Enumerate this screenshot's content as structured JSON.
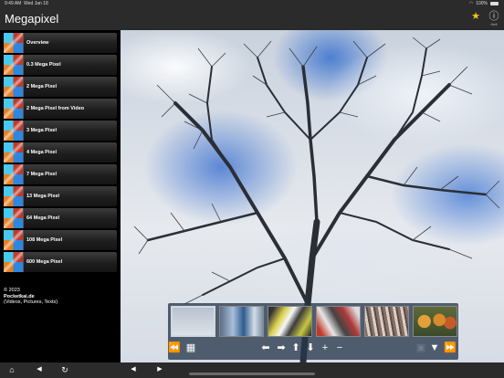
{
  "status_bar": {
    "time": "9:49 AM",
    "date": "Wed Jan 18",
    "battery": "100%"
  },
  "header": {
    "title": "Megapixel",
    "favorite_icon": "star-icon",
    "info_icon": "info-icon",
    "info_label": "Hell",
    "colors": {
      "star": "#f5c518",
      "bar": "#2b2b2b"
    }
  },
  "sidebar": {
    "items": [
      {
        "label": "Overview"
      },
      {
        "label": "0.3 Mega Pixel"
      },
      {
        "label": "2 Mega Pixel"
      },
      {
        "label": "2 Mega Pixel from Video"
      },
      {
        "label": "3 Mega Pixel"
      },
      {
        "label": "4 Mega Pixel"
      },
      {
        "label": "7 Mega Pixel"
      },
      {
        "label": "13 Mega Pixel"
      },
      {
        "label": "64 Mega Pixel"
      },
      {
        "label": "108 Mega Pixel"
      },
      {
        "label": "600 Mega Pixel"
      }
    ],
    "footer": {
      "copyright": "© 2023",
      "site": "Pocketkai.de",
      "tagline": "(Videos, Pictures, Texts)"
    }
  },
  "gallery": {
    "thumbnails": [
      {
        "name": "tree-thumbnail",
        "selected": true
      },
      {
        "name": "building-thumbnail",
        "selected": false
      },
      {
        "name": "graffiti-thumbnail",
        "selected": false
      },
      {
        "name": "graffiti-red-thumbnail",
        "selected": false
      },
      {
        "name": "branches-thumbnail",
        "selected": false
      },
      {
        "name": "pumpkins-thumbnail",
        "selected": false
      }
    ],
    "controls": {
      "prev_page": "⏪",
      "grid": "▦",
      "left": "⬅",
      "right": "➡",
      "up": "⬆",
      "down": "⬇",
      "zoom_in": "+",
      "zoom_out": "−",
      "fit": "▣",
      "collapse": "▼",
      "next_page": "⏩"
    }
  },
  "bottom_bar": {
    "home": "⌂",
    "back": "◀",
    "reload": "↻",
    "prev": "◀",
    "next": "▶"
  }
}
